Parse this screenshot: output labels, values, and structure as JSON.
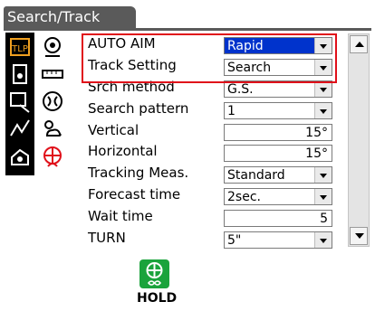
{
  "title": "Search/Track",
  "rows": [
    {
      "label": "AUTO AIM",
      "value": "Rapid",
      "kind": "dropdown",
      "selected": true
    },
    {
      "label": "Track Setting",
      "value": "Search",
      "kind": "dropdown",
      "selected": false
    },
    {
      "label": "Srch method",
      "value": "G.S.",
      "kind": "dropdown",
      "selected": false
    },
    {
      "label": "Search pattern",
      "value": "1",
      "kind": "dropdown",
      "selected": false
    },
    {
      "label": "Vertical",
      "value": "15°",
      "kind": "number",
      "selected": false
    },
    {
      "label": "Horizontal",
      "value": "15°",
      "kind": "number",
      "selected": false
    },
    {
      "label": "Tracking Meas.",
      "value": "Standard",
      "kind": "dropdown",
      "selected": false
    },
    {
      "label": "Forecast time",
      "value": "2sec.",
      "kind": "dropdown",
      "selected": false
    },
    {
      "label": "Wait time",
      "value": "5",
      "kind": "number",
      "selected": false
    },
    {
      "label": "TURN",
      "value": "5\"",
      "kind": "dropdown",
      "selected": false
    }
  ],
  "softkey": {
    "label": "HOLD",
    "icon": "hold-icon"
  },
  "left_icons": [
    "program-icon",
    "distance-icon",
    "measure-icon",
    "survey-icon",
    "polyline-icon",
    "sensor-icon",
    "settings-icon",
    "weather-icon",
    "search-track-icon",
    "eye-icon"
  ],
  "colors": {
    "title_tab": "#5a5a5a",
    "highlight": "#e0101a",
    "selection": "#0033cc",
    "hold_button": "#1aa33c"
  }
}
